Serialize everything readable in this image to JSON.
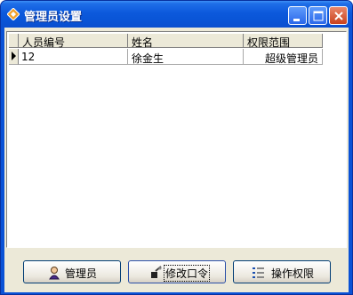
{
  "window": {
    "title": "管理员设置"
  },
  "grid": {
    "columns": [
      "人员编号",
      "姓名",
      "权限范围"
    ],
    "rows": [
      {
        "id": "12",
        "name": "徐金生",
        "scope": "超级管理员"
      }
    ]
  },
  "buttons": {
    "admin": "管理员",
    "change_password": "修改口令",
    "permissions": "操作权限"
  },
  "colors": {
    "titlebar": "#0a55d7",
    "face": "#ece9d8",
    "close": "#c9411d"
  }
}
